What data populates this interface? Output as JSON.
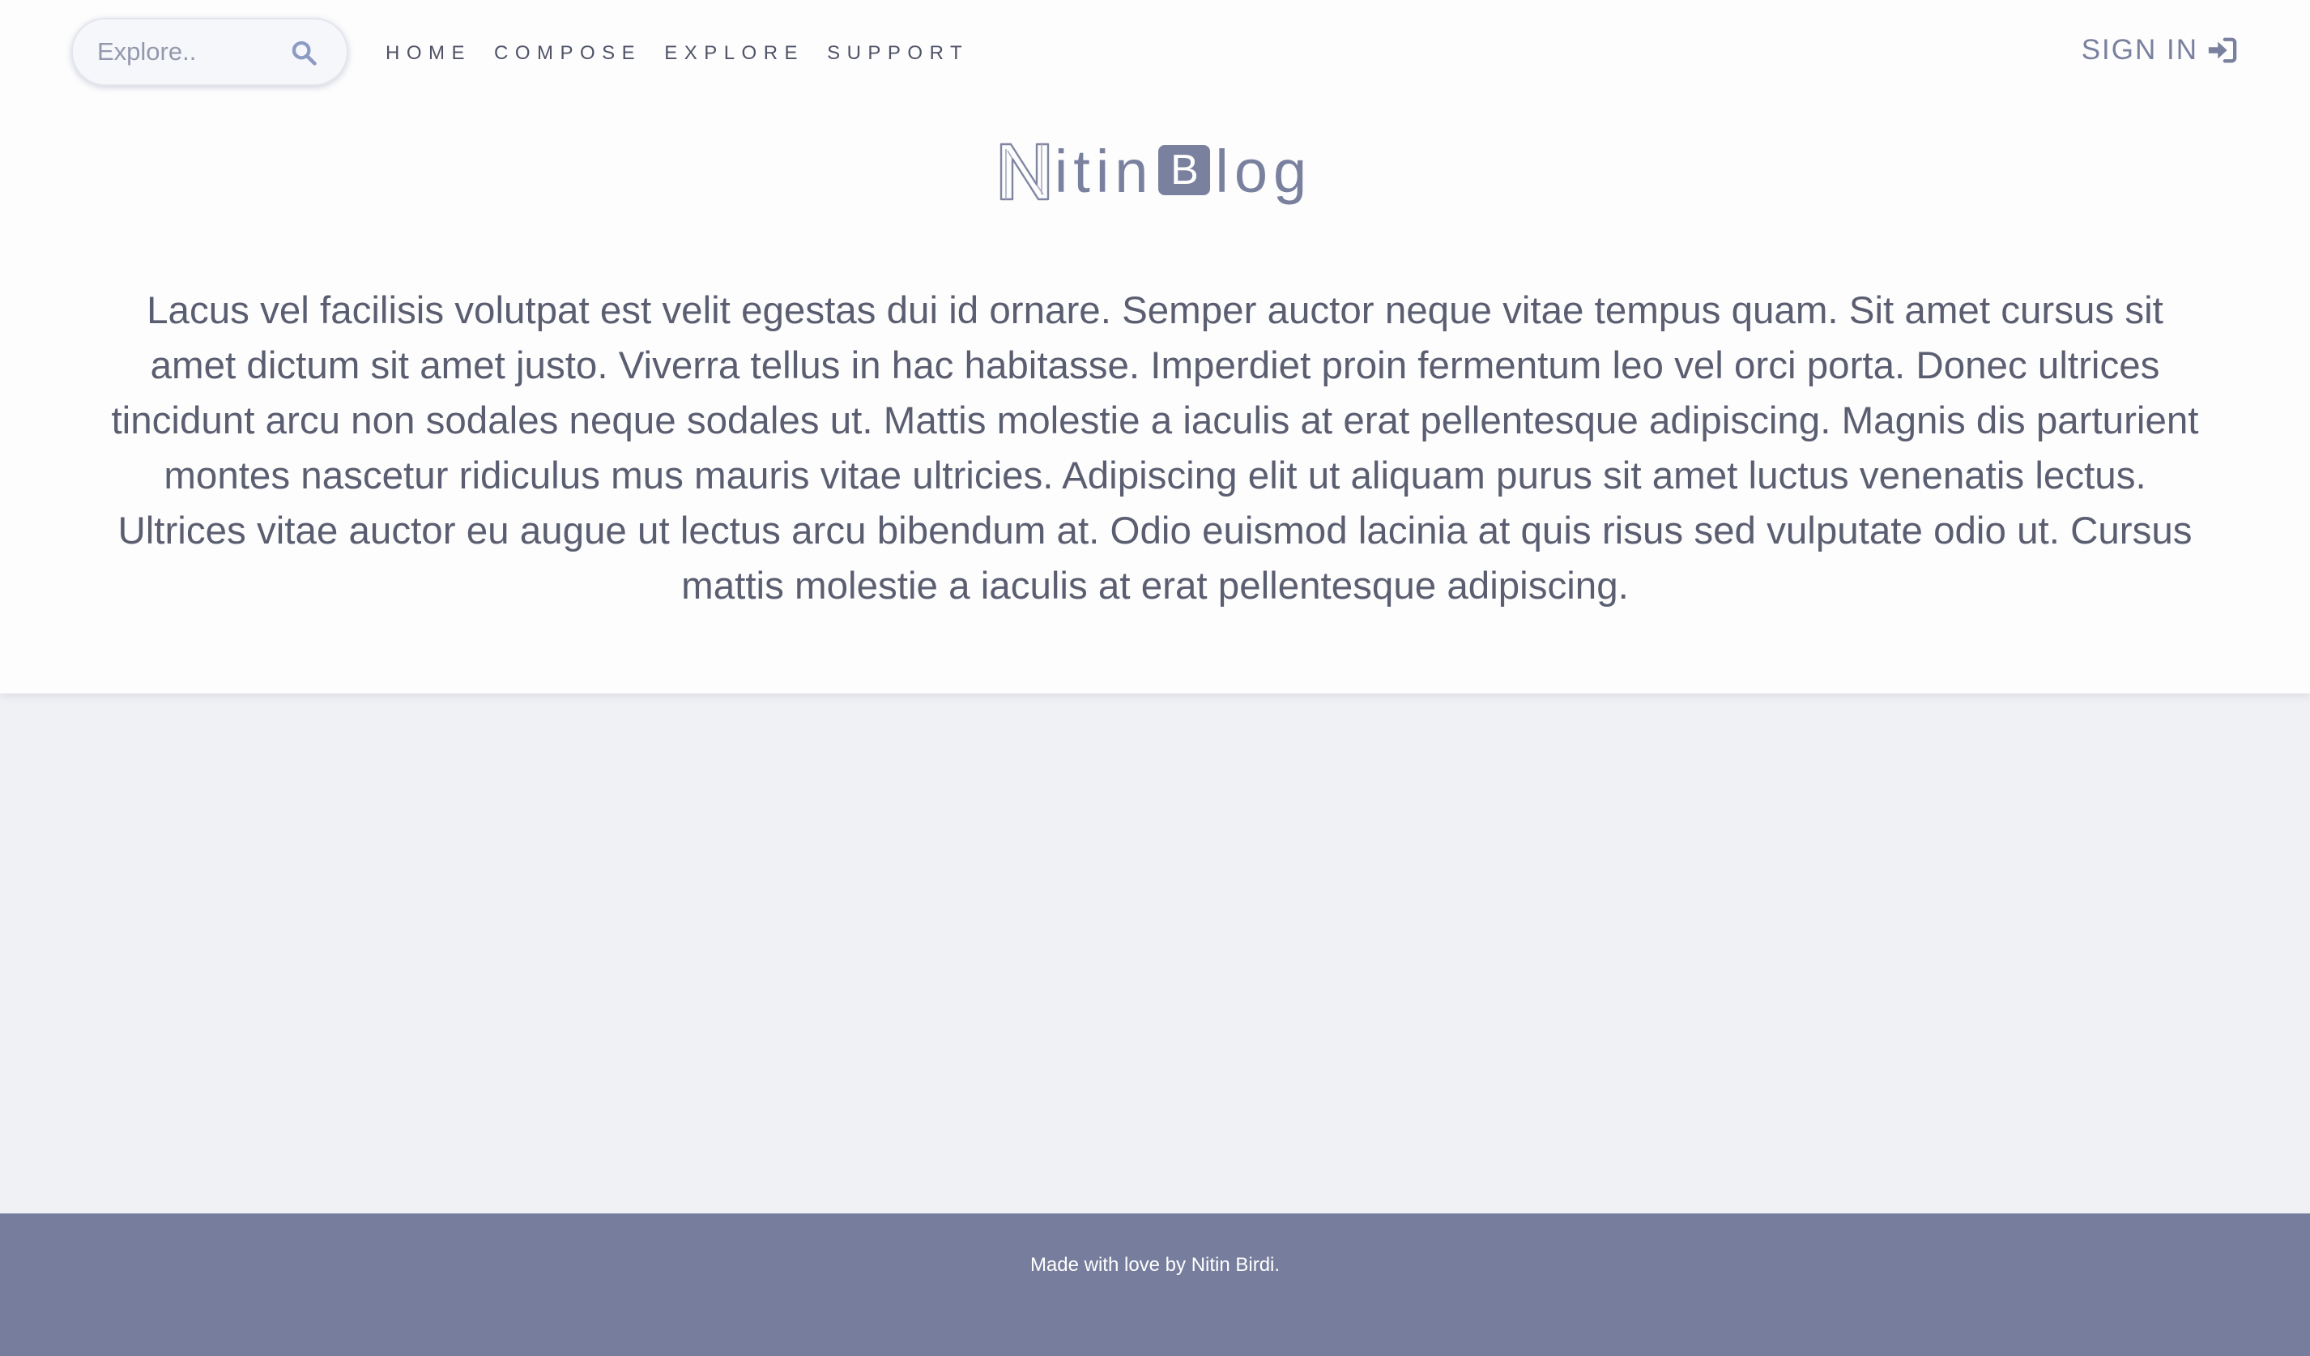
{
  "search": {
    "placeholder": "Explore..",
    "value": ""
  },
  "nav": {
    "items": [
      {
        "label": "HOME"
      },
      {
        "label": "COMPOSE"
      },
      {
        "label": "EXPLORE"
      },
      {
        "label": "SUPPORT"
      }
    ],
    "signin_label": "SIGN IN"
  },
  "brand": {
    "logo_letter": "N",
    "part1": "itin",
    "box_letter": "B",
    "part2": "log"
  },
  "intro": {
    "text": "Lacus vel facilisis volutpat est velit egestas dui id ornare. Semper auctor neque vitae tempus quam. Sit amet cursus sit amet dictum sit amet justo. Viverra tellus in hac habitasse. Imperdiet proin fermentum leo vel orci porta. Donec ultrices tincidunt arcu non sodales neque sodales ut. Mattis molestie a iaculis at erat pellentesque adipiscing. Magnis dis parturient montes nascetur ridiculus mus mauris vitae ultricies. Adipiscing elit ut aliquam purus sit amet luctus venenatis lectus. Ultrices vitae auctor eu augue ut lectus arcu bibendum at. Odio euismod lacinia at quis risus sed vulputate odio ut. Cursus mattis molestie a iaculis at erat pellentesque adipiscing."
  },
  "footer": {
    "text": "Made with love by Nitin Birdi."
  },
  "icons": {
    "search": "search-icon",
    "signin": "sign-in-icon",
    "logo": "outlined-n-logo-icon"
  },
  "colors": {
    "accent": "#7a819e",
    "footer_bg": "#777e9d",
    "page_bg": "#f0f1f5",
    "hero_bg": "#fdfdfe",
    "body_text": "#5a5e70"
  }
}
